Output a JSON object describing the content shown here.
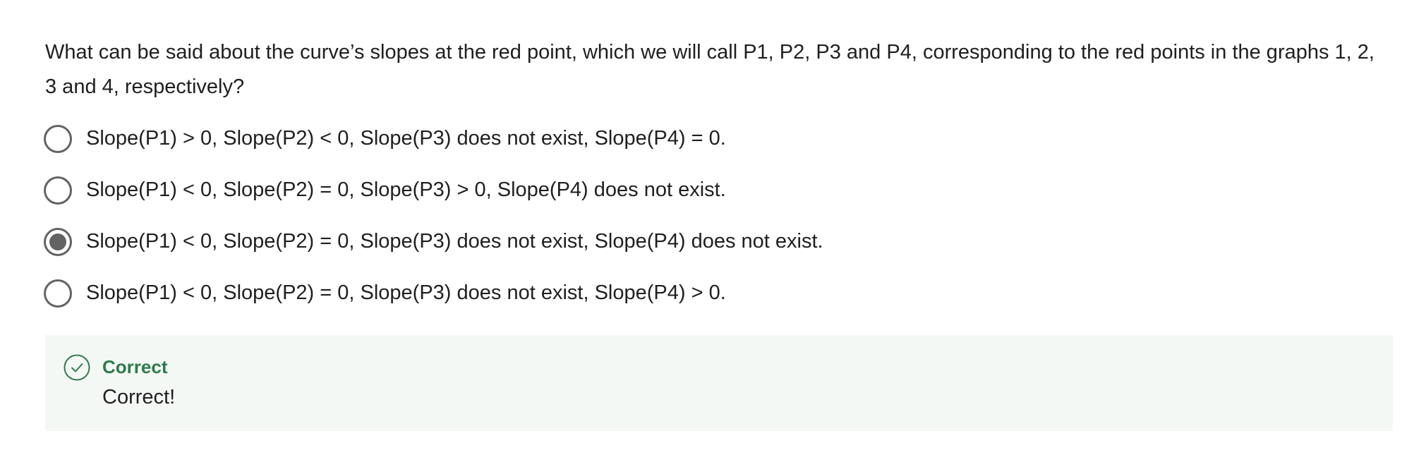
{
  "question": {
    "text": "What can be said about the curve’s slopes at the red point, which we will call P1, P2, P3 and P4, corresponding to the red points in the graphs 1, 2, 3 and 4, respectively?"
  },
  "options": [
    {
      "label": "Slope(P1) > 0, Slope(P2) < 0, Slope(P3) does not exist, Slope(P4) = 0.",
      "selected": false
    },
    {
      "label": "Slope(P1) < 0, Slope(P2) = 0, Slope(P3) > 0, Slope(P4) does not exist.",
      "selected": false
    },
    {
      "label": "Slope(P1) < 0, Slope(P2) = 0, Slope(P3) does not exist, Slope(P4) does not exist.",
      "selected": true
    },
    {
      "label": "Slope(P1) < 0, Slope(P2) = 0, Slope(P3) does not exist, Slope(P4) > 0.",
      "selected": false
    }
  ],
  "feedback": {
    "status": "Correct",
    "message": "Correct!",
    "icon": "check-circle-icon",
    "accent_color": "#2e7b4c",
    "background_color": "#f4f8f5"
  },
  "colors": {
    "radio": "#636363",
    "text": "#1f1f1f"
  }
}
